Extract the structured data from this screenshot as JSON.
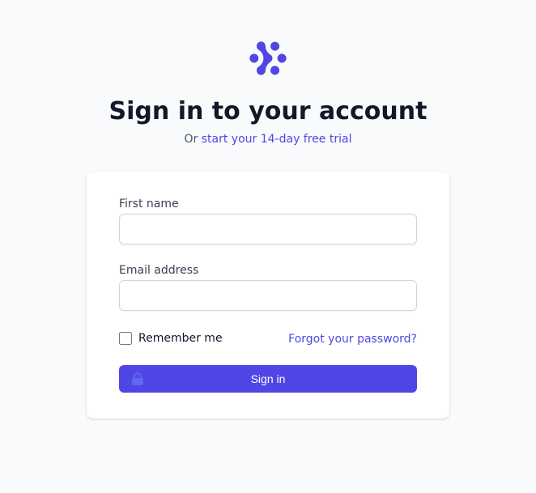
{
  "brand": {
    "accent": "#4f46e5",
    "accent_light": "#6366f1"
  },
  "header": {
    "title": "Sign in to your account",
    "or_prefix": "Or ",
    "trial_link": "start your 14-day free trial"
  },
  "form": {
    "first_name": {
      "label": "First name",
      "value": ""
    },
    "email": {
      "label": "Email address",
      "value": ""
    },
    "remember_label": "Remember me",
    "forgot_label": "Forgot your password?",
    "submit_label": "Sign in"
  },
  "icons": {
    "logo": "brand-mark-icon",
    "lock": "lock-closed-icon"
  }
}
